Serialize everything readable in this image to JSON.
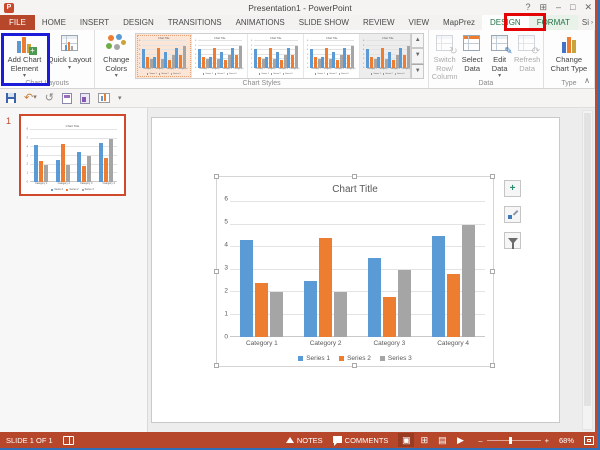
{
  "colors": {
    "accent": "#B7472A",
    "contextual_green": "#217346",
    "annotation_red": "#E30505",
    "annotation_blue": "#1C1CD8",
    "chart_blue": "#5B9BD5",
    "chart_orange": "#ED7D31",
    "chart_gray": "#A5A5A5"
  },
  "titlebar": {
    "title": "Presentation1 - PowerPoint",
    "app_icon_label": "P",
    "controls": [
      {
        "name": "help-icon",
        "glyph": "?"
      },
      {
        "name": "ribbon-display-options-icon",
        "glyph": "⊞"
      },
      {
        "name": "minimize-icon",
        "glyph": "–"
      },
      {
        "name": "maximize-icon",
        "glyph": "□"
      },
      {
        "name": "close-icon",
        "glyph": "✕"
      }
    ]
  },
  "tabs": {
    "file_label": "FILE",
    "items": [
      "HOME",
      "INSERT",
      "DESIGN",
      "TRANSITIONS",
      "ANIMATIONS",
      "SLIDE SHOW",
      "REVIEW",
      "VIEW",
      "MapPrez"
    ],
    "contextual": [
      {
        "label": "DESIGN",
        "active": true
      },
      {
        "label": "FORMAT",
        "active": false
      }
    ],
    "overflow_label": "Si"
  },
  "ribbon": {
    "chart_layouts": {
      "group_label": "Chart Layouts",
      "buttons": [
        {
          "label": "Add Chart Element",
          "dropdown": "▾",
          "highlighted": true,
          "icon": "add-chart-element-icon"
        },
        {
          "label": "Quick Layout",
          "dropdown": "▾",
          "highlighted": false,
          "icon": "quick-layout-icon"
        }
      ]
    },
    "chart_styles": {
      "group_label": "Chart Styles",
      "change_colors_label": "Change Colors",
      "change_colors_dropdown": "▾",
      "gallery_item_count": 5,
      "selected_index": 0,
      "scroll_icons": [
        "gallery-up-icon",
        "gallery-down-icon",
        "gallery-more-icon"
      ]
    },
    "data_group": {
      "group_label": "Data",
      "buttons": [
        {
          "label": "Switch Row/ Column",
          "enabled": false,
          "icon": "switch-row-column-icon",
          "dropdown": ""
        },
        {
          "label": "Select Data",
          "enabled": true,
          "icon": "select-data-icon",
          "dropdown": ""
        },
        {
          "label": "Edit Data",
          "enabled": true,
          "icon": "edit-data-icon",
          "dropdown": "▾"
        },
        {
          "label": "Refresh Data",
          "enabled": false,
          "icon": "refresh-data-icon",
          "dropdown": ""
        }
      ]
    },
    "type_group": {
      "group_label": "Type",
      "button_label": "Change Chart Type",
      "icon": "change-chart-type-icon"
    },
    "collapse_glyph": "∧"
  },
  "quick_access": {
    "icons": [
      "save-icon",
      "undo-icon",
      "redo-icon",
      "clipboard-icon",
      "paste-icon",
      "slide-layout-icon",
      "qat-dropdown-icon"
    ]
  },
  "thumbnail_panel": {
    "slide_number": "1"
  },
  "chart_data": {
    "type": "bar",
    "title": "Chart Title",
    "categories": [
      "Category 1",
      "Category 2",
      "Category 3",
      "Category 4"
    ],
    "series": [
      {
        "name": "Series 1",
        "color": "#5B9BD5",
        "values": [
          4.3,
          2.5,
          3.5,
          4.5
        ]
      },
      {
        "name": "Series 2",
        "color": "#ED7D31",
        "values": [
          2.4,
          4.4,
          1.8,
          2.8
        ]
      },
      {
        "name": "Series 3",
        "color": "#A5A5A5",
        "values": [
          2.0,
          2.0,
          3.0,
          5.0
        ]
      }
    ],
    "ylim": [
      0,
      6
    ],
    "yticks": [
      0,
      1,
      2,
      3,
      4,
      5,
      6
    ],
    "grid": true,
    "legend_position": "bottom"
  },
  "chart_side_tools": [
    {
      "name": "chart-elements-button",
      "tool": "plus"
    },
    {
      "name": "chart-styles-button",
      "tool": "brush"
    },
    {
      "name": "chart-filters-button",
      "tool": "funnel"
    }
  ],
  "statusbar": {
    "slide_indicator": "SLIDE 1 OF 1",
    "notes_label": "NOTES",
    "comments_label": "COMMENTS",
    "view_icons": [
      {
        "name": "normal-view-icon",
        "glyph": "▣",
        "active": true
      },
      {
        "name": "slide-sorter-icon",
        "glyph": "⊞",
        "active": false
      },
      {
        "name": "reading-view-icon",
        "glyph": "▤",
        "active": false
      },
      {
        "name": "slideshow-icon",
        "glyph": "▶",
        "active": false
      }
    ],
    "zoom_out_glyph": "–",
    "zoom_in_glyph": "+",
    "zoom_level": "68%"
  }
}
